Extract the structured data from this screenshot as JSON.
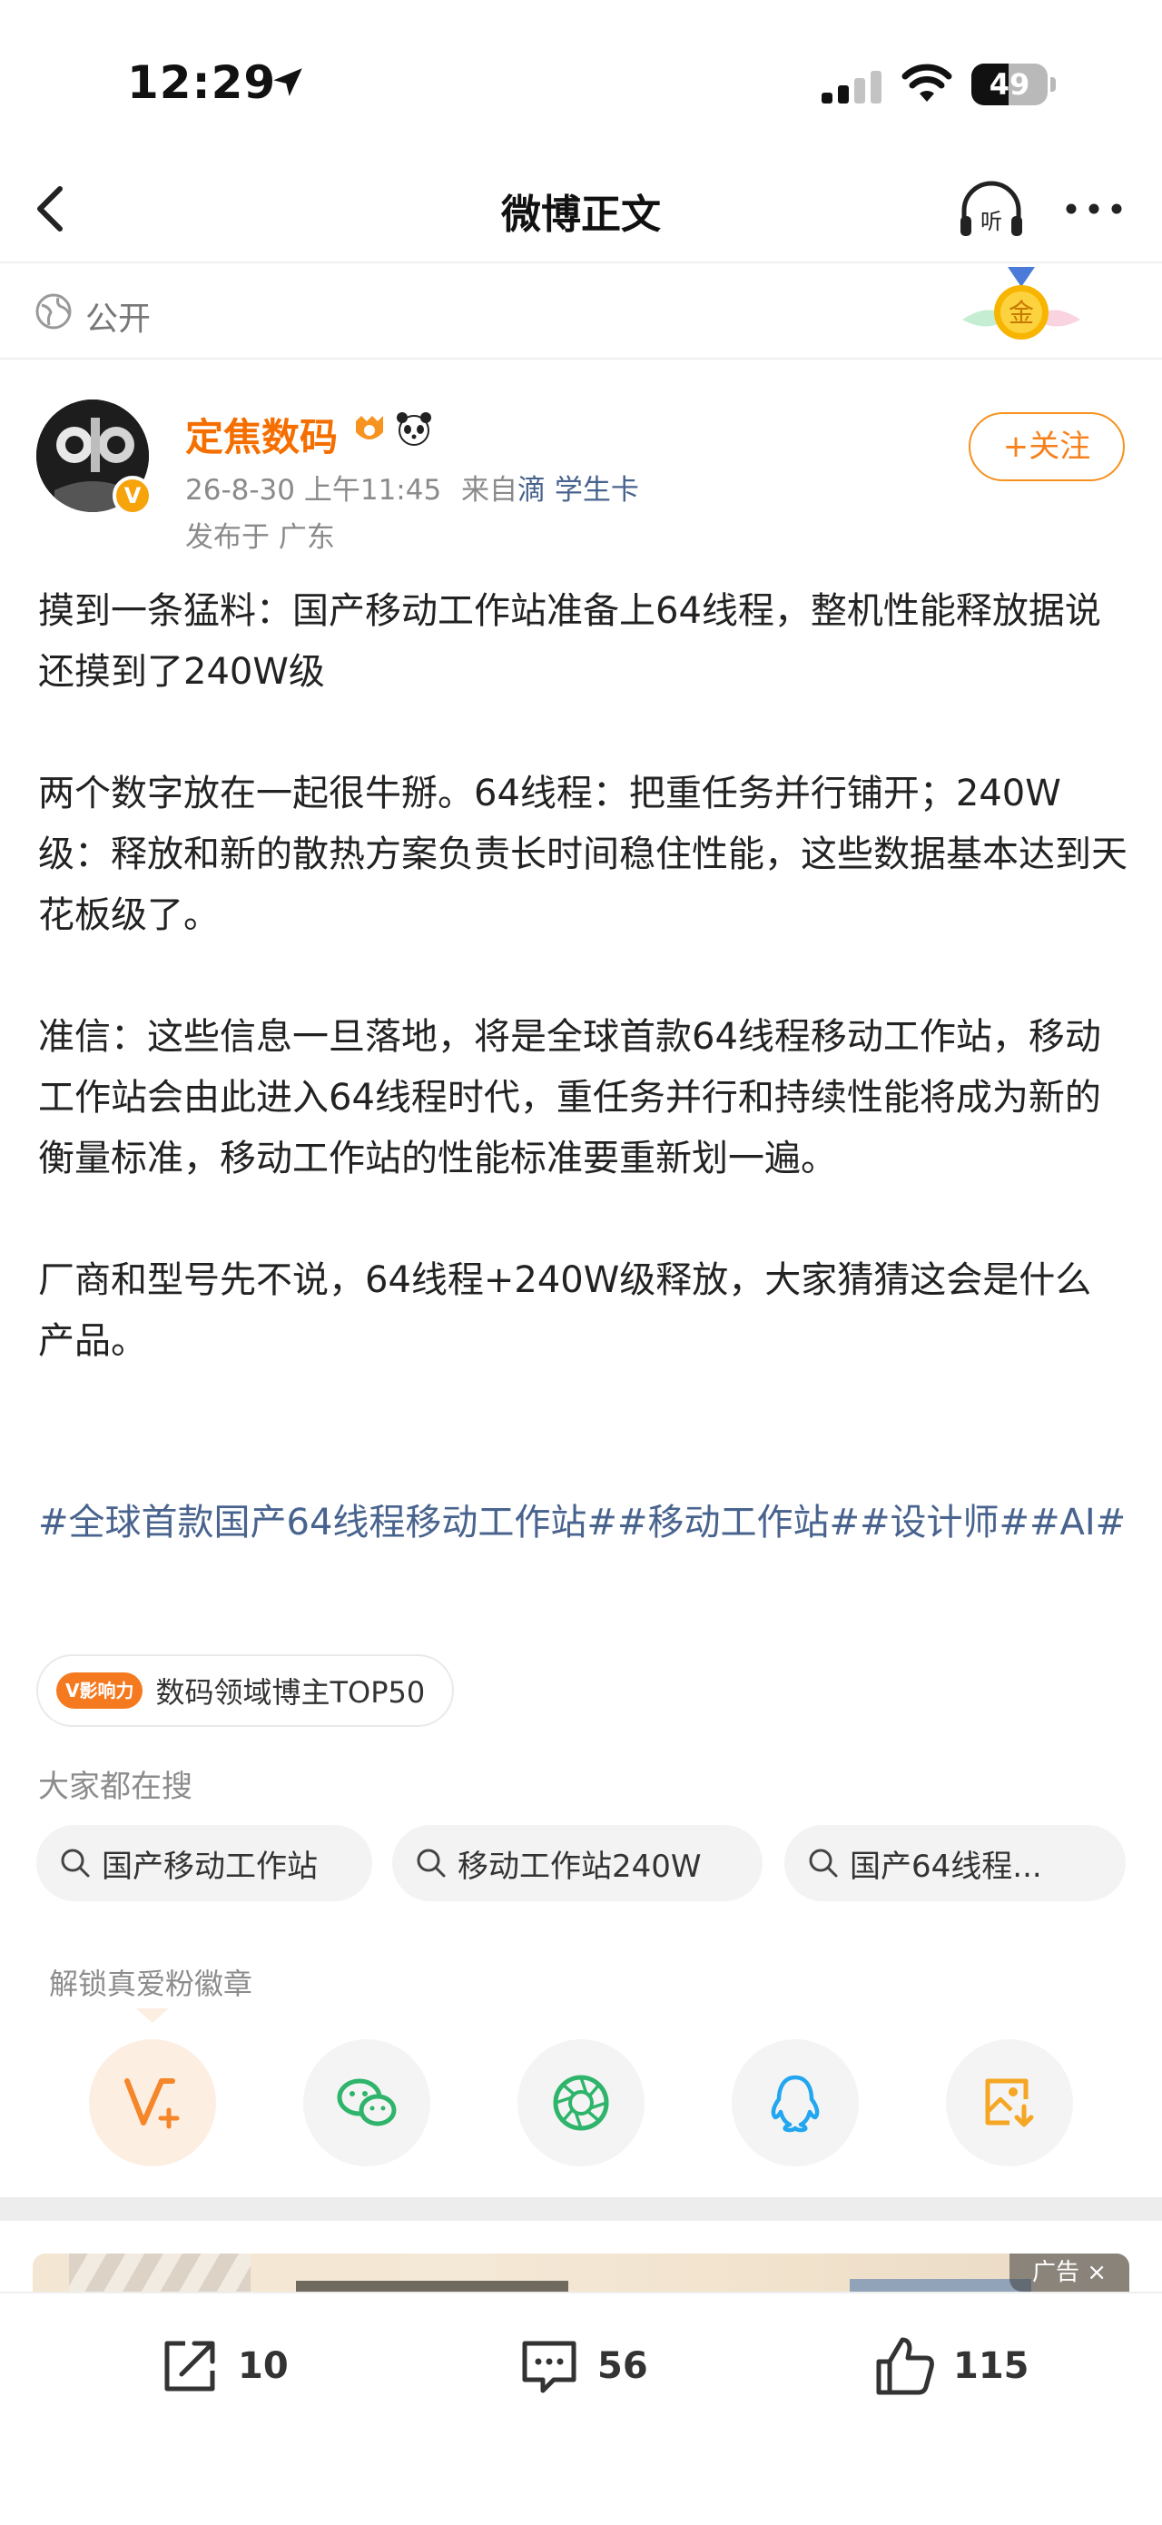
{
  "status_bar": {
    "time": "12:29",
    "battery_percent": "49",
    "battery_level": 0.49
  },
  "nav": {
    "title": "微博正文"
  },
  "visibility": {
    "label": "公开",
    "medal_char": "金"
  },
  "author": {
    "name": "定焦数码",
    "timestamp": "26-8-30 上午11:45",
    "from_prefix": "来自",
    "source": "滴 学生卡",
    "location": "发布于 广东",
    "follow_label": "+关注",
    "verified_badge": "V"
  },
  "post": {
    "paragraphs": [
      "摸到一条猛料：国产移动工作站准备上64线程，整机性能释放据说还摸到了240W级",
      "两个数字放在一起很牛掰。64线程：把重任务并行铺开；240W级：释放和新的散热方案负责长时间稳住性能，这些数据基本达到天花板级了。",
      "准信：这些信息一旦落地，将是全球首款64线程移动工作站，移动工作站会由此进入64线程时代，重任务并行和持续性能将成为新的衡量标准，移动工作站的性能标准要重新划一遍。",
      "厂商和型号先不说，64线程+240W级释放，大家猜猜这会是什么产品。"
    ],
    "hashtags": "#全球首款国产64线程移动工作站##移动工作站##设计师##AI#"
  },
  "influence": {
    "tag": "V影响力",
    "text": "数码领域博主TOP50"
  },
  "search": {
    "title": "大家都在搜",
    "chips": [
      "国产移动工作站",
      "移动工作站240W",
      "国产64线程..."
    ]
  },
  "share": {
    "unlock_label": "解锁真爱粉徽章",
    "icons": [
      "v-plus-icon",
      "wechat-icon",
      "moments-icon",
      "qq-icon",
      "save-image-icon"
    ]
  },
  "ad": {
    "label": "广告 ×"
  },
  "actions": {
    "repost_count": "10",
    "comment_count": "56",
    "like_count": "115"
  },
  "colors": {
    "accent": "#f6811c",
    "link": "#48638e",
    "author_name": "#f56e00"
  }
}
